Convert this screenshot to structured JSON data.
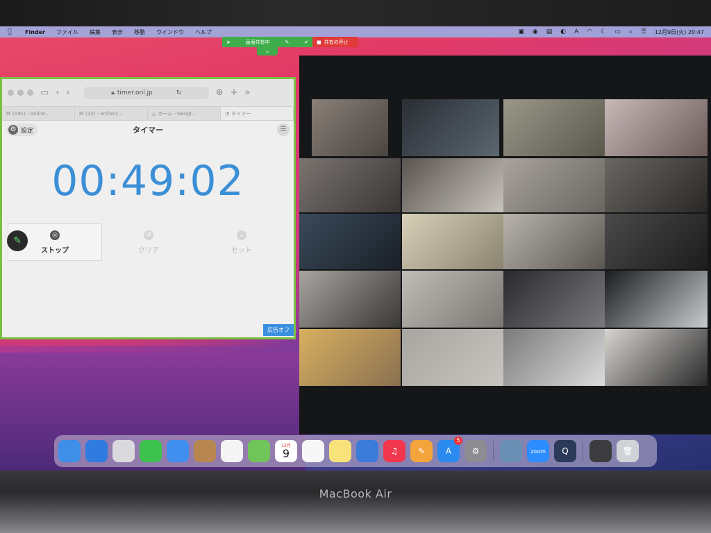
{
  "menubar": {
    "apple_icon": "apple-logo-icon",
    "items": [
      "Finder",
      "ファイル",
      "編集",
      "表示",
      "移動",
      "ウインドウ",
      "ヘルプ"
    ],
    "clock": "12月9日(火)  20:47"
  },
  "share_bar": {
    "sharing_label": "画面共有中",
    "stop_label": "共有の停止"
  },
  "safari": {
    "url": "timer.onl.jp",
    "tabs": [
      "(191) - online...",
      "(22) - online1...",
      "ホーム - Googl...",
      "タイマー"
    ],
    "page": {
      "settings_label": "設定",
      "title": "タイマー",
      "timer_value": "00:49:02",
      "buttons": {
        "stop": "ストップ",
        "clear": "クリア",
        "set": "セット"
      },
      "ad_label": "広告オフ"
    }
  },
  "dock": {
    "items": [
      {
        "name": "finder",
        "color": "#3d8fe8"
      },
      {
        "name": "safari",
        "color": "#2f7be0"
      },
      {
        "name": "launchpad",
        "color": "#d9d9de"
      },
      {
        "name": "messages",
        "color": "#3ec24f"
      },
      {
        "name": "mail",
        "color": "#3f8ef0"
      },
      {
        "name": "contacts",
        "color": "#b8874f"
      },
      {
        "name": "photos",
        "color": "#f5f5f5"
      },
      {
        "name": "maps",
        "color": "#6fc45a"
      },
      {
        "name": "calendar",
        "color": "#ffffff",
        "month": "12月",
        "day": "9"
      },
      {
        "name": "reminders",
        "color": "#f7f7f7"
      },
      {
        "name": "notes",
        "color": "#f8e27a"
      },
      {
        "name": "keynote",
        "color": "#3b7bd9"
      },
      {
        "name": "music",
        "color": "#f2364d"
      },
      {
        "name": "pages",
        "color": "#f3a43a"
      },
      {
        "name": "app-store",
        "color": "#2b8af0",
        "badge": "5"
      },
      {
        "name": "system-preferences",
        "color": "#8c8c92"
      },
      {
        "name": "preview",
        "color": "#6a8fb4"
      },
      {
        "name": "zoom",
        "color": "#2d8cff",
        "label": "zoom"
      },
      {
        "name": "quicktime",
        "color": "#2a3a58"
      },
      {
        "name": "screenshot-folder",
        "color": "#3c3c40"
      },
      {
        "name": "trash",
        "color": "#cfd2d6"
      }
    ]
  },
  "base_brand": "MacBook Air"
}
